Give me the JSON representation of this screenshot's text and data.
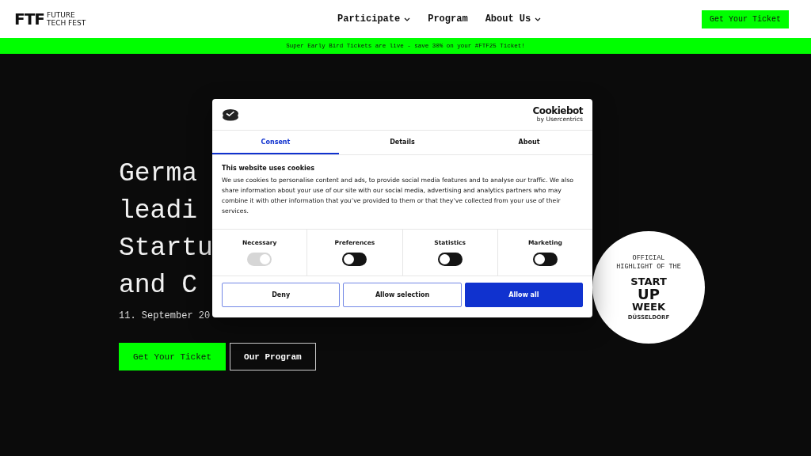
{
  "header": {
    "logo_mark": "FTF",
    "logo_text": [
      "FUTURE",
      "TECH FEST"
    ],
    "nav": [
      {
        "label": "Participate",
        "dropdown": true
      },
      {
        "label": "Program",
        "dropdown": false
      },
      {
        "label": "About Us",
        "dropdown": true
      }
    ],
    "cta": "Get Your Ticket"
  },
  "banner": "Super Early Bird Tickets are live - save 30% on your #FTF25 Ticket!",
  "hero": {
    "title_lines": [
      "Germa",
      "leadi",
      "Startu",
      "and C"
    ],
    "date": "11. September 20",
    "buttons": [
      {
        "label": "Get Your Ticket",
        "kind": "primary"
      },
      {
        "label": "Our Program",
        "kind": "outline"
      }
    ]
  },
  "badge": {
    "top": [
      "OFFICIAL",
      "HIGHLIGHT OF THE"
    ],
    "brand": [
      "START",
      "UP",
      "WEEK"
    ],
    "city": "DÜSSELDORF"
  },
  "cookie_dialog": {
    "brand": "Cookiebot",
    "brand_sub": "by Usercentrics",
    "tabs": [
      {
        "label": "Consent",
        "selected": true
      },
      {
        "label": "Details",
        "selected": false
      },
      {
        "label": "About",
        "selected": false
      }
    ],
    "heading": "This website uses cookies",
    "body": "We use cookies to personalise content and ads, to provide social media features and to analyse our traffic. We also share information about your use of our site with our social media, advertising and analytics partners who may combine it with other information that you’ve provided to them or that they’ve collected from your use of their services.",
    "toggles": [
      {
        "label": "Necessary",
        "checked": true,
        "disabled": true
      },
      {
        "label": "Preferences",
        "checked": false,
        "disabled": false
      },
      {
        "label": "Statistics",
        "checked": false,
        "disabled": false
      },
      {
        "label": "Marketing",
        "checked": false,
        "disabled": false
      }
    ],
    "buttons": [
      {
        "label": "Deny",
        "kind": "outline"
      },
      {
        "label": "Allow selection",
        "kind": "outline"
      },
      {
        "label": "Allow all",
        "kind": "primary"
      }
    ]
  }
}
